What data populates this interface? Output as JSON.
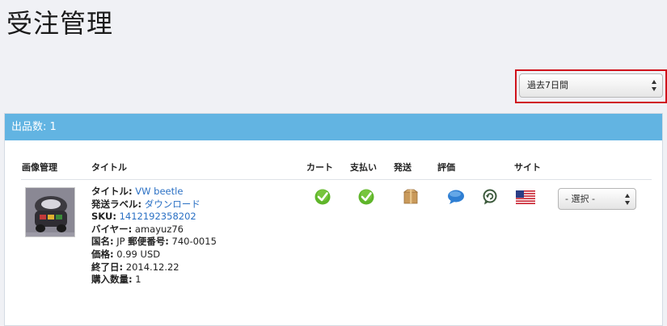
{
  "page": {
    "title": "受注管理"
  },
  "filter": {
    "period_value": "過去7日間"
  },
  "panel": {
    "header": "出品数: 1"
  },
  "table": {
    "headers": {
      "image": "画像管理",
      "title": "タイトル",
      "cart": "カート",
      "payment": "支払い",
      "shipping": "発送",
      "feedback": "評価",
      "site": "サイト"
    }
  },
  "order": {
    "title_label": "タイトル:",
    "title_value": "VW beetle",
    "label_label": "発送ラベル:",
    "label_value": "ダウンロード",
    "sku_label": "SKU:",
    "sku_value": "1412192358202",
    "buyer_label": "バイヤー:",
    "buyer_value": "amayuz76",
    "country_label": "国名:",
    "country_value": "JP",
    "zip_label": "郵便番号:",
    "zip_value": "740-0015",
    "price_label": "価格:",
    "price_value": "0.99 USD",
    "end_label": "終了日:",
    "end_value": "2014.12.22",
    "qty_label": "購入数量:",
    "qty_value": "1",
    "action_value": "- 選択 -",
    "status_icons": [
      "check-icon",
      "check-icon",
      "package-icon",
      "speech-bubble-icon",
      "reply-icon",
      "us-flag-icon"
    ]
  },
  "colors": {
    "header_bar": "#62b4e2",
    "highlight_border": "#d0121b",
    "link": "#2a70c4"
  }
}
